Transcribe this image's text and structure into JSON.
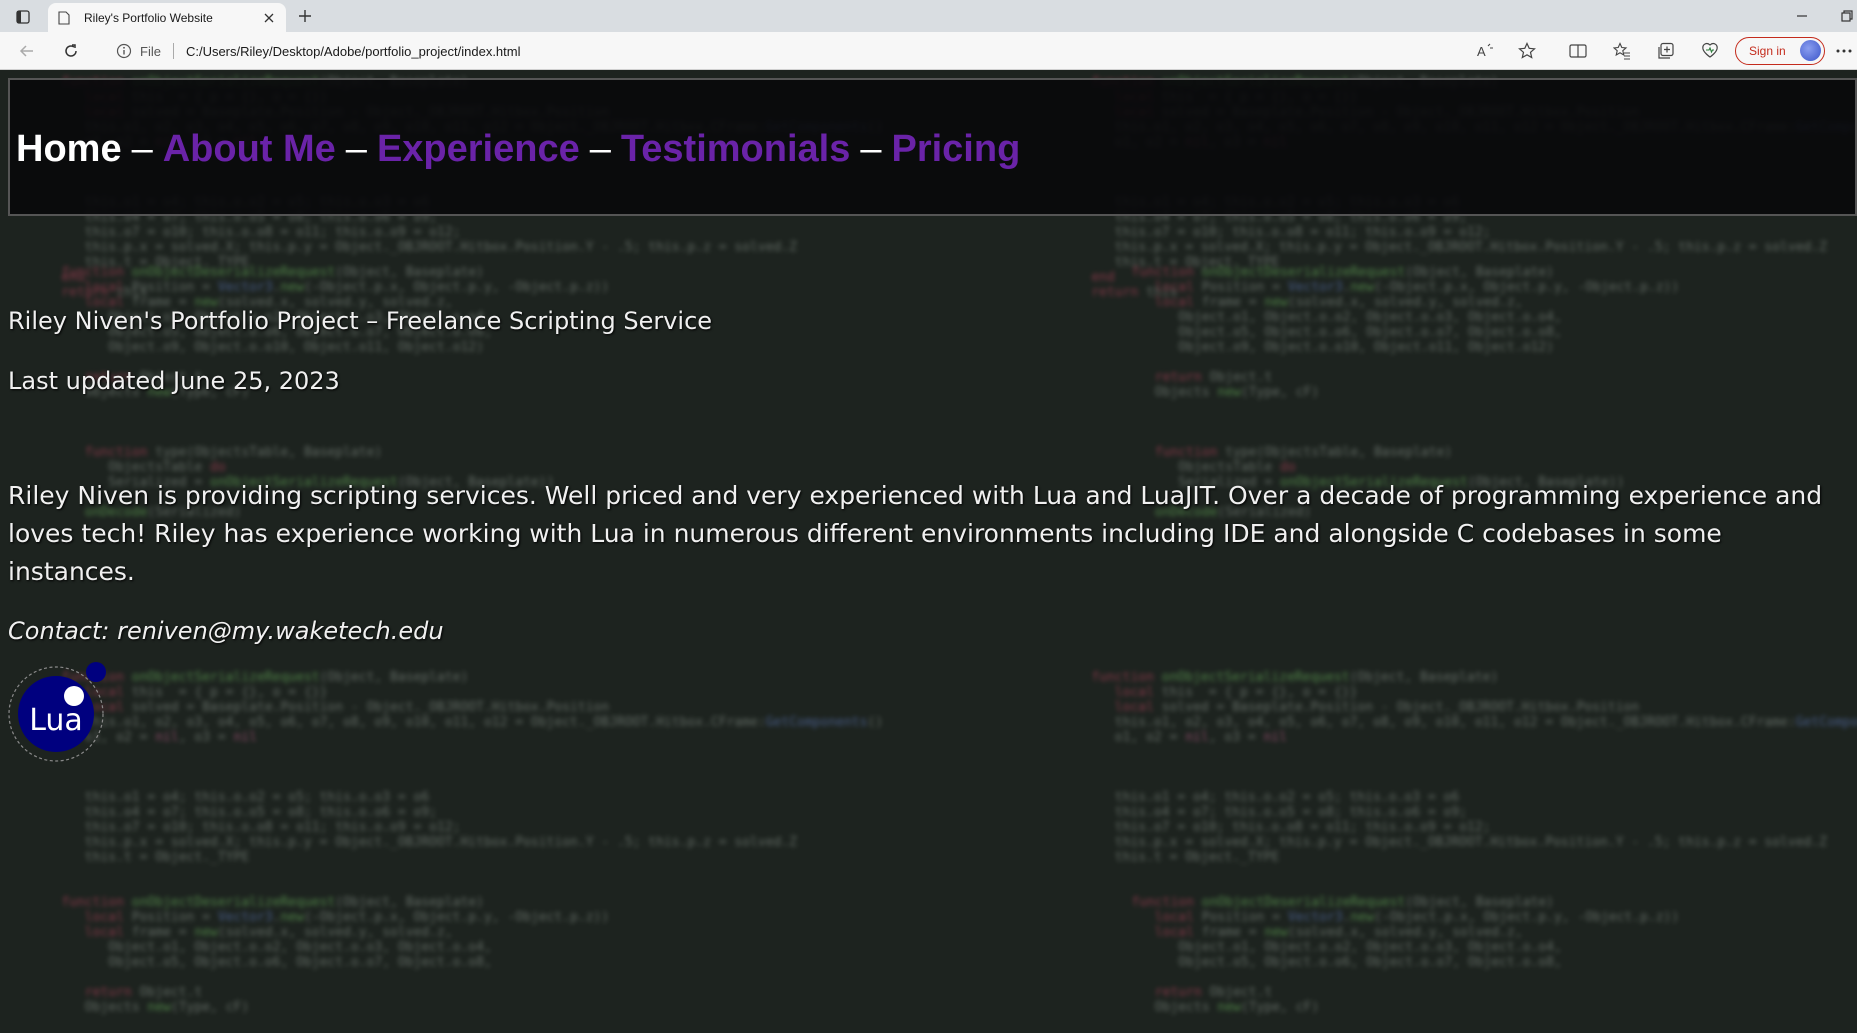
{
  "browser": {
    "tab_title": "Riley's Portfolio Website",
    "url_scheme_label": "File",
    "url": "C:/Users/Riley/Desktop/Adobe/portfolio_project/index.html",
    "signin_label": "Sign in"
  },
  "nav": {
    "home": "Home",
    "about": "About Me",
    "experience": "Experience",
    "testimonials": "Testimonials",
    "pricing": "Pricing",
    "separator": "–"
  },
  "content": {
    "headline": "Riley Niven's Portfolio Project – Freelance Scripting Service",
    "updated": "Last updated June 25, 2023",
    "bio": "Riley Niven is providing scripting services. Well priced and very experienced with Lua and LuaJIT. Over a decade of programming experience and loves tech! Riley has experience working with Lua in numerous different environments including IDE and alongside C codebases in some instances.",
    "contact": "Contact: reniven@my.waketech.edu"
  },
  "logo": {
    "text": "Lua"
  },
  "colors": {
    "nav_link": "#6a23a8",
    "lua_blue": "#00007f"
  }
}
